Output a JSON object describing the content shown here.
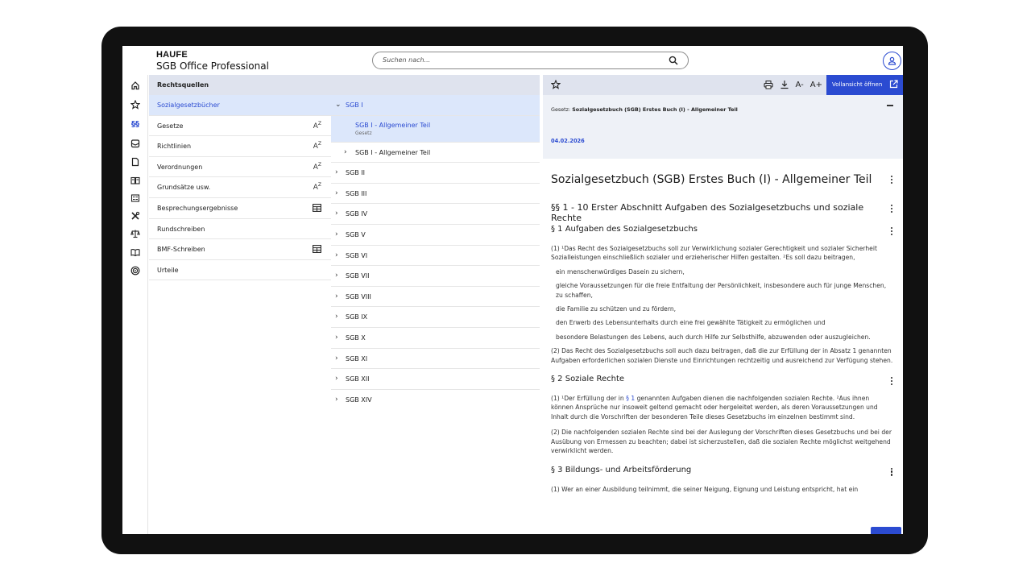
{
  "header": {
    "brand_top": "HAUFE",
    "brand_bottom": "SGB Office Professional",
    "search_placeholder": "Suchen nach..."
  },
  "rail": {
    "icons": [
      "home-icon",
      "star-icon",
      "paragraph-icon",
      "inbox-icon",
      "document-icon",
      "book-icon",
      "news-icon",
      "tools-icon",
      "scale-icon",
      "book-open-icon",
      "target-icon"
    ],
    "active_label": "§§"
  },
  "col1": {
    "header": "Rechtsquellen",
    "items": [
      {
        "label": "Sozialgesetzbücher",
        "suffix": ""
      },
      {
        "label": "Gesetze",
        "suffix": "AZ"
      },
      {
        "label": "Richtlinien",
        "suffix": "AZ"
      },
      {
        "label": "Verordnungen",
        "suffix": "AZ"
      },
      {
        "label": "Grundsätze usw.",
        "suffix": "AZ"
      },
      {
        "label": "Besprechungsergebnisse",
        "suffix": "table"
      },
      {
        "label": "Rundschreiben",
        "suffix": ""
      },
      {
        "label": "BMF-Schreiben",
        "suffix": "table"
      },
      {
        "label": "Urteile",
        "suffix": ""
      }
    ]
  },
  "col2": {
    "open_item": "SGB I",
    "sub_selected_title": "SGB I - Allgemeiner Teil",
    "sub_selected_type": "Gesetz",
    "sub_other": "SGB I - Allgemeiner Teil",
    "items": [
      "SGB II",
      "SGB III",
      "SGB IV",
      "SGB V",
      "SGB VI",
      "SGB VII",
      "SGB VIII",
      "SGB IX",
      "SGB X",
      "SGB XI",
      "SGB XII",
      "SGB XIV"
    ]
  },
  "doc": {
    "toolbar": {
      "font_smaller": "A-",
      "font_larger": "A+",
      "fullview": "Vollansicht öffnen"
    },
    "meta_prefix": "Gesetz: ",
    "meta_title": "Sozialgesetzbuch (SGB) Erstes Buch (I) - Allgemeiner Teil",
    "date": "04.02.2026",
    "title": "Sozialgesetzbuch (SGB) Erstes Buch (I) - Allgemeiner Teil",
    "section_range": "§§ 1 - 10 Erster Abschnitt Aufgaben des Sozialgesetzbuchs und soziale Rechte",
    "s1_title": "§ 1 Aufgaben des Sozialgesetzbuchs",
    "s1_p1": "(1) ¹Das Recht des Sozialgesetzbuchs soll zur Verwirklichung sozialer Gerechtigkeit und sozialer Sicherheit Sozialleistungen einschließlich sozialer und erzieherischer Hilfen gestalten. ²Es soll dazu beitragen,",
    "s1_list": [
      "ein menschenwürdiges Dasein zu sichern,",
      "gleiche Voraussetzungen für die freie Entfaltung der Persönlichkeit, insbesondere auch für junge Menschen, zu schaffen,",
      "die Familie zu schützen und zu fördern,",
      "den Erwerb des Lebensunterhalts durch eine frei gewählte Tätigkeit zu ermöglichen und",
      "besondere Belastungen des Lebens, auch durch Hilfe zur Selbsthilfe, abzuwenden oder auszugleichen."
    ],
    "s1_p2": "(2) Das Recht des Sozialgesetzbuchs soll auch dazu beitragen, daß die zur Erfüllung der in Absatz 1 genannten Aufgaben erforderlichen sozialen Dienste und Einrichtungen rechtzeitig und ausreichend zur Verfügung stehen.",
    "s2_title": "§ 2 Soziale Rechte",
    "s2_p1_a": "(1) ¹Der Erfüllung der in ",
    "s2_p1_link": "§ 1",
    "s2_p1_b": " genannten Aufgaben dienen die nachfolgenden sozialen Rechte. ²Aus ihnen können Ansprüche nur insoweit geltend gemacht oder hergeleitet werden, als deren Voraussetzungen und Inhalt durch die Vorschriften der besonderen Teile dieses Gesetzbuchs im einzelnen bestimmt sind.",
    "s2_p2": "(2) Die nachfolgenden sozialen Rechte sind bei der Auslegung der Vorschriften dieses Gesetzbuchs und bei der Ausübung von Ermessen zu beachten; dabei ist sicherzustellen, daß die sozialen Rechte möglichst weitgehend verwirklicht werden.",
    "s3_title": "§ 3 Bildungs- und Arbeitsförderung",
    "s3_p1": "(1) Wer an einer Ausbildung teilnimmt, die seiner Neigung, Eignung und Leistung entspricht, hat ein"
  }
}
